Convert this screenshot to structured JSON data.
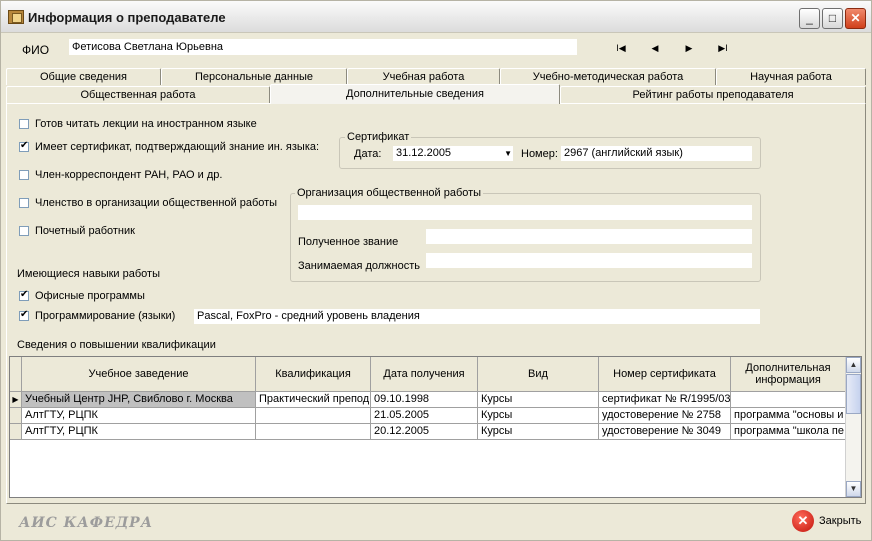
{
  "window": {
    "title": "Информация о преподавателе",
    "controls": {
      "minimize": "_",
      "maximize": "□",
      "close": "✕"
    }
  },
  "header": {
    "fio_label": "ФИО",
    "fio_value": "Фетисова Светлана Юрьевна",
    "nav": {
      "first": "I◀",
      "prev": "◀",
      "next": "▶",
      "last": "▶I"
    }
  },
  "tabs": {
    "row1": [
      "Общие сведения",
      "Персональные данные",
      "Учебная работа",
      "Учебно-методическая работа",
      "Научная работа"
    ],
    "row2": [
      "Общественная работа",
      "Дополнительные сведения",
      "Рейтинг работы преподавателя"
    ],
    "active": "Дополнительные сведения"
  },
  "checks": {
    "foreign_lectures": {
      "label": "Готов читать лекции на иностранном языке",
      "checked": false
    },
    "certificate": {
      "label": "Имеет сертификат, подтверждающий знание ин. языка:",
      "checked": true
    },
    "corr_member": {
      "label": "Член-корреспондент РАН, РАО и др.",
      "checked": false
    },
    "public_org": {
      "label": "Членство в организации общественной работы",
      "checked": false
    },
    "honorary": {
      "label": "Почетный работник",
      "checked": false
    }
  },
  "certificate": {
    "group_title": "Сертификат",
    "date_label": "Дата:",
    "date_value": "31.12.2005",
    "number_label": "Номер:",
    "number_value": "2967 (английский язык)"
  },
  "organization": {
    "group_title": "Организация общественной работы",
    "name_value": "",
    "title_label": "Полученное звание",
    "title_value": "",
    "position_label": "Занимаемая должность",
    "position_value": ""
  },
  "skills": {
    "heading": "Имеющиеся навыки работы",
    "office": {
      "label": "Офисные программы",
      "checked": true
    },
    "programming": {
      "label": "Программирование (языки)",
      "checked": true,
      "value": "Pascal, FoxPro - средний уровень владения"
    }
  },
  "qualification": {
    "heading": "Сведения о повышении квалификации",
    "columns": [
      "Учебное заведение",
      "Квалификация",
      "Дата получения",
      "Вид",
      "Номер сертификата",
      "Дополнительная информация"
    ],
    "rows": [
      [
        "Учебный Центр JHP, Свиблово г. Москва",
        "Практический препод",
        "09.10.1998",
        "Курсы",
        "сертификат № R/1995/03",
        ""
      ],
      [
        "АлтГТУ, РЦПК",
        "",
        "21.05.2005",
        "Курсы",
        "удостоверение № 2758",
        "программа \"основы и"
      ],
      [
        "АлтГТУ, РЦПК",
        "",
        "20.12.2005",
        "Курсы",
        "удостоверение № 3049",
        "программа \"школа пе"
      ]
    ],
    "current_row_marker": "▶"
  },
  "footer": {
    "logo": "АИС КАФЕДРА",
    "close_label": "Закрыть",
    "close_icon": "✕"
  }
}
